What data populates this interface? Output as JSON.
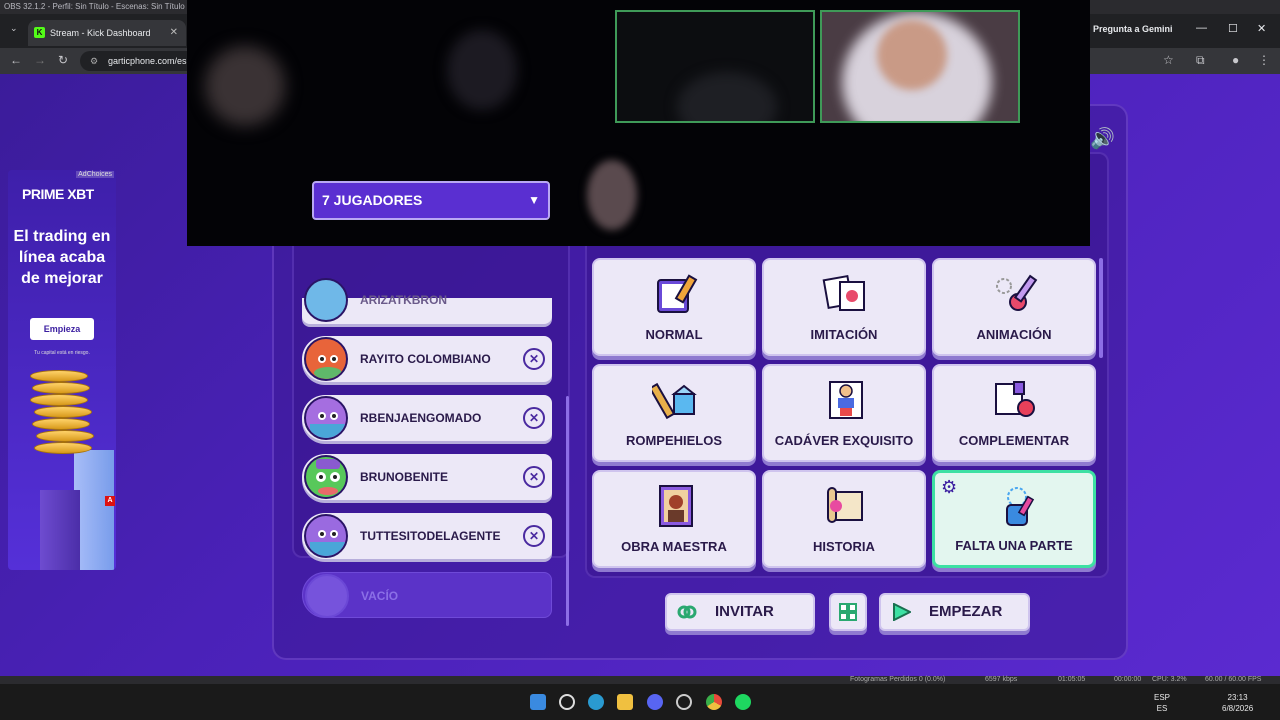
{
  "obs": {
    "title": "OBS 32.1.2 - Perfil: Sin Título - Escenas: Sin Título",
    "status_frames": "Fotogramas Perdidos 0 (0.0%)",
    "status_kbps": "6597 kbps",
    "status_time1": "01:05:05",
    "status_time2": "00:00:00",
    "status_cpu": "CPU: 3.2%",
    "status_fps": "60.00 / 60.00 FPS"
  },
  "browser": {
    "tab_title": "Stream - Kick Dashboard",
    "tab_close": "✕",
    "url": "garticphone.com/es",
    "gemini_label": "Pregunta a Gemini",
    "back_icon": "←",
    "forward_icon": "→",
    "reload_icon": "↻",
    "star_icon": "☆",
    "minimize": "—",
    "maximize": "☐",
    "close": "✕"
  },
  "ad": {
    "label": "AdChoices",
    "brand": "PRIME XBT",
    "headline": "El trading en línea acaba de mejorar",
    "button": "Empieza",
    "disclaimer": "Tu capital está en riesgo.",
    "badge": "A"
  },
  "players": {
    "count_label": "7 JUGADORES",
    "caret": "▼",
    "list": [
      {
        "name": "ARIZATKBRON",
        "color": "#6fb8e8"
      },
      {
        "name": "RAYITO COLOMBIANO",
        "color": "#e8643a"
      },
      {
        "name": "RBENJAENGOMADO",
        "color": "#a56ee0"
      },
      {
        "name": "BRUNOBENITE",
        "color": "#58c85a"
      },
      {
        "name": "TUTTESITODELAGENTE",
        "color": "#9a6ae0"
      }
    ],
    "remove_icon": "✕",
    "empty_label": "VACÍO"
  },
  "modes": [
    {
      "label": "NORMAL",
      "icon": "notebook-pencil-icon"
    },
    {
      "label": "IMITACIÓN",
      "icon": "copy-drawings-icon"
    },
    {
      "label": "ANIMACIÓN",
      "icon": "animation-pencil-icon"
    },
    {
      "label": "ROMPEHIELOS",
      "icon": "hammer-ice-icon"
    },
    {
      "label": "CADÁVER EXQUISITO",
      "icon": "exquisite-corpse-icon"
    },
    {
      "label": "COMPLEMENTAR",
      "icon": "complement-icon"
    },
    {
      "label": "OBRA MAESTRA",
      "icon": "masterpiece-icon"
    },
    {
      "label": "HISTORIA",
      "icon": "story-scroll-icon"
    },
    {
      "label": "FALTA UNA PARTE",
      "icon": "missing-piece-icon",
      "selected": true
    }
  ],
  "actions": {
    "invite": "INVITAR",
    "start": "EMPEZAR"
  },
  "taskbar": {
    "lang_top": "ESP",
    "lang_bottom": "ES",
    "time": "23:13",
    "date": "6/8/2026"
  }
}
